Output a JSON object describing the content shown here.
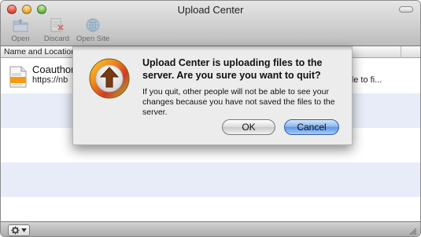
{
  "window": {
    "title": "Upload Center"
  },
  "toolbar": [
    {
      "label": "Open",
      "icon": "open-folder-icon"
    },
    {
      "label": "Discard",
      "icon": "discard-icon"
    },
    {
      "label": "Open Site",
      "icon": "globe-icon"
    }
  ],
  "list": {
    "column_header": "Name and Location",
    "item": {
      "name": "Coauthor",
      "url": "https://nb",
      "status_text": "Open the file to fi..."
    }
  },
  "dialog": {
    "title": "Upload Center is uploading files to the server. Are you sure you want to quit?",
    "message": "If you quit, other people will not be able to see your changes because you have not saved the files to the server.",
    "ok_label": "OK",
    "cancel_label": "Cancel"
  },
  "colors": {
    "row_alt": "#e7ecf8",
    "default_button": "#5e97e5"
  }
}
